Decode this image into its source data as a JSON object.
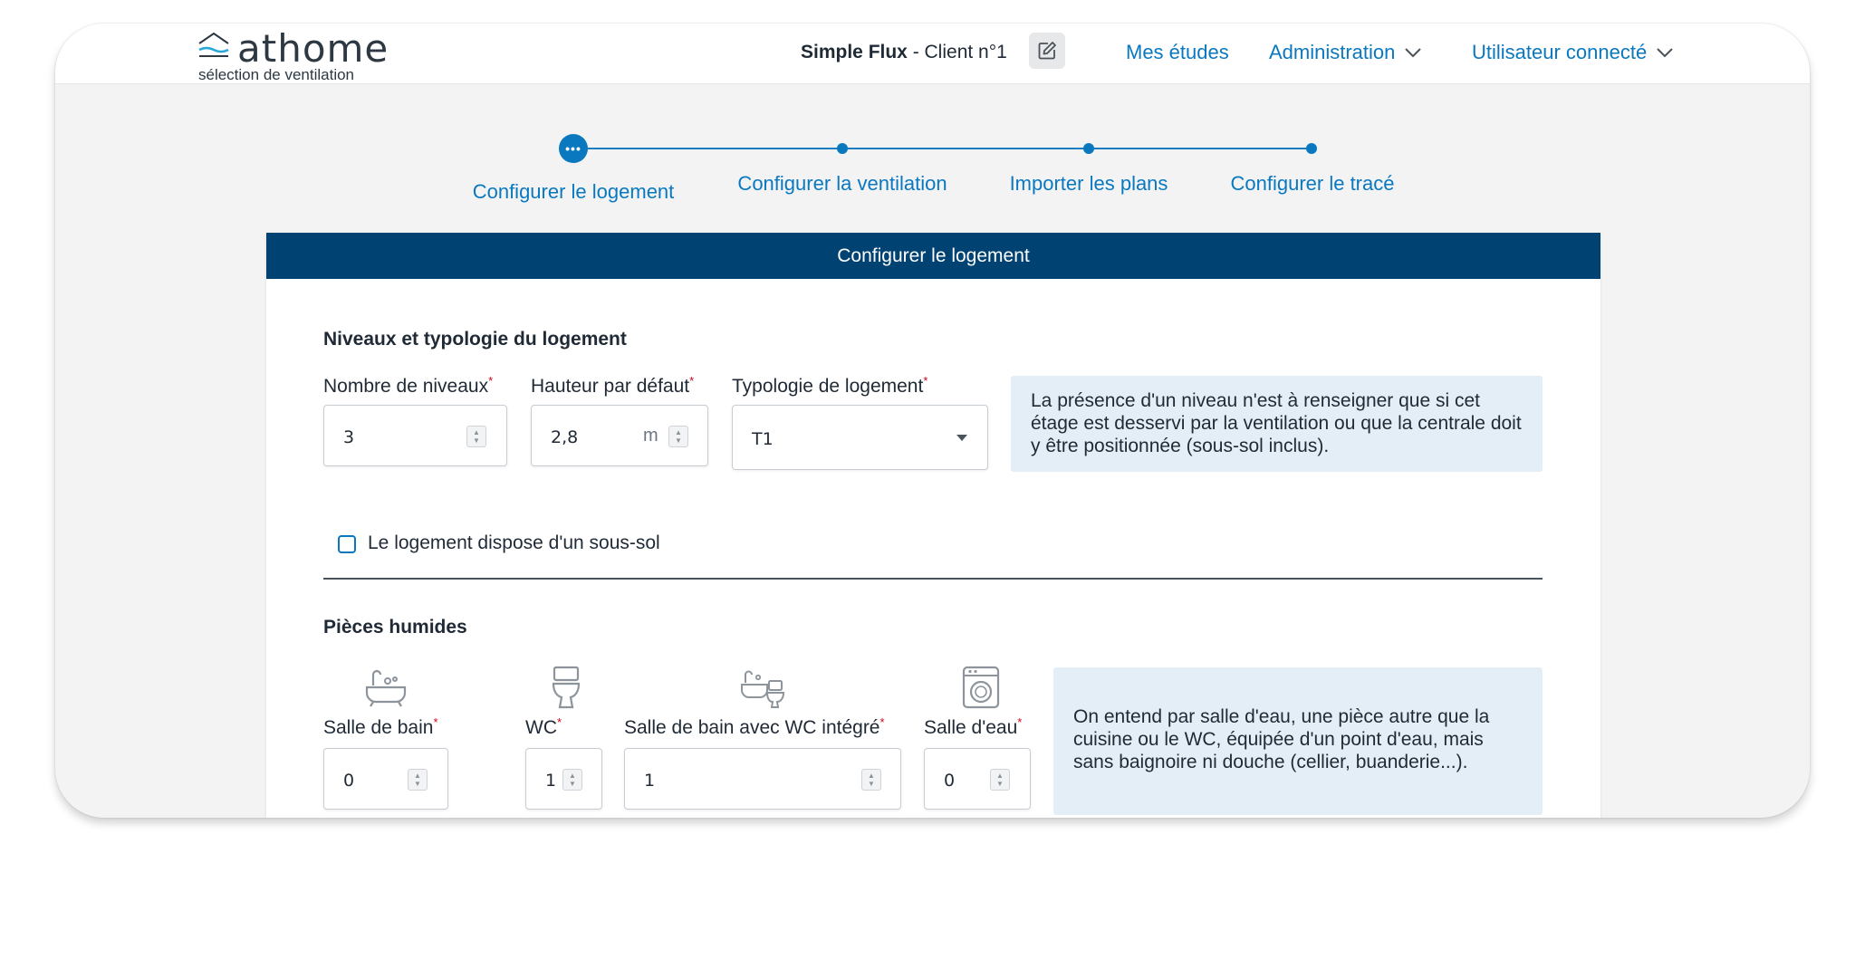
{
  "app": {
    "logo_name": "athome",
    "logo_subtitle": "sélection de ventilation"
  },
  "header": {
    "project_bold": "Simple Flux",
    "project_rest": " - Client n°1",
    "nav": {
      "studies": "Mes études",
      "admin": "Administration",
      "user": "Utilisateur connecté"
    }
  },
  "stepper": {
    "steps": [
      {
        "label": "Configurer le logement",
        "state": "current"
      },
      {
        "label": "Configurer la ventilation",
        "state": "upcoming"
      },
      {
        "label": "Importer les plans",
        "state": "upcoming"
      },
      {
        "label": "Configurer le tracé",
        "state": "upcoming"
      }
    ],
    "current_glyph": "•••"
  },
  "card": {
    "title": "Configurer le logement",
    "levels_section": {
      "title": "Niveaux et typologie du logement",
      "levels_label": "Nombre de niveaux",
      "levels_value": "3",
      "height_label": "Hauteur par défaut",
      "height_value": "2,8",
      "height_unit": "m",
      "typology_label": "Typologie de logement",
      "typology_value": "T1",
      "required_mark": "*",
      "info": "La présence d'un niveau n'est à renseigner que si cet étage est desservi par la ventilation ou que la centrale doit y être positionnée (sous-sol inclus).",
      "basement_label": "Le logement dispose d'un sous-sol",
      "basement_checked": false
    },
    "wet_rooms_section": {
      "title": "Pièces humides",
      "bathroom_label": "Salle de bain",
      "bathroom_value": "0",
      "wc_label": "WC",
      "wc_value": "1",
      "bath_wc_label": "Salle de bain avec WC intégré",
      "bath_wc_value": "1",
      "water_room_label": "Salle d'eau",
      "water_room_value": "0",
      "info": "On entend par salle d'eau, une pièce autre que la cuisine ou le WC, équipée d'un point d'eau, mais sans baignoire ni douche (cellier, buanderie...)."
    }
  },
  "colors": {
    "accent": "#0a78bf",
    "card_header": "#004272",
    "info_bg": "#e4eef6",
    "required": "#d0021b"
  },
  "icons": [
    "home-wave-logo-icon",
    "edit-icon",
    "chevron-down-icon",
    "bathtub-icon",
    "toilet-icon",
    "bath-with-wc-icon",
    "washing-machine-icon"
  ]
}
